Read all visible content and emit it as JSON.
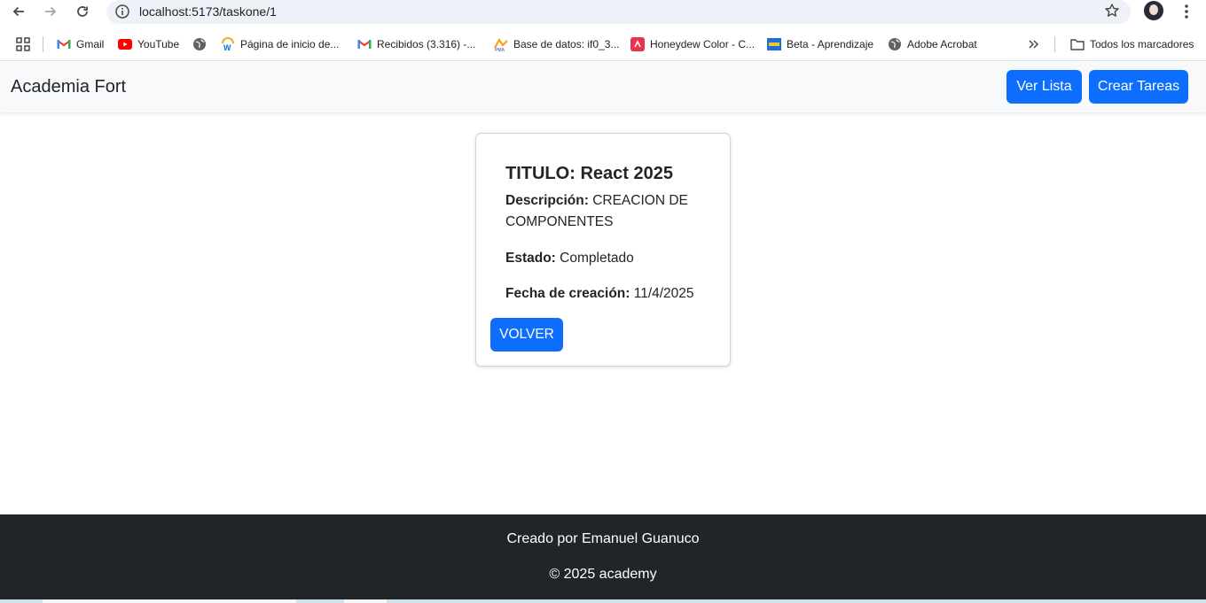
{
  "browser": {
    "url": "localhost:5173/taskone/1",
    "bookmarks": [
      {
        "label": "Gmail",
        "icon": "gmail-icon"
      },
      {
        "label": "YouTube",
        "icon": "youtube-icon"
      },
      {
        "label": "",
        "icon": "globe-icon"
      },
      {
        "label": "Página de inicio de...",
        "icon": "workday-icon"
      },
      {
        "label": "Recibidos (3.316) -...",
        "icon": "gmail-icon"
      },
      {
        "label": "Base de datos: if0_3...",
        "icon": "phpmyadmin-icon"
      },
      {
        "label": "Honeydew Color - C...",
        "icon": "honeydew-icon"
      },
      {
        "label": "Beta - Aprendizaje",
        "icon": "beta-icon"
      },
      {
        "label": "Adobe Acrobat",
        "icon": "globe-icon"
      }
    ],
    "all_bookmarks_label": "Todos los marcadores"
  },
  "navbar": {
    "brand": "Academia Fort",
    "ver_lista_label": "Ver Lista",
    "crear_tareas_label": "Crear Tareas"
  },
  "task": {
    "title_label": "TITULO:",
    "title_value": "React 2025",
    "description_label": "Descripción:",
    "description_value": "CREACION DE COMPONENTES",
    "status_label": "Estado:",
    "status_value": "Completado",
    "date_label": "Fecha de creación:",
    "date_value": "11/4/2025",
    "back_button_label": "VOLVER"
  },
  "footer": {
    "credit": "Creado por Emanuel Guanuco",
    "copyright": "© 2025 academy"
  },
  "colors": {
    "primary": "#0d6efd",
    "navbar_bg": "#f8f9fa",
    "footer_bg": "#212529"
  }
}
